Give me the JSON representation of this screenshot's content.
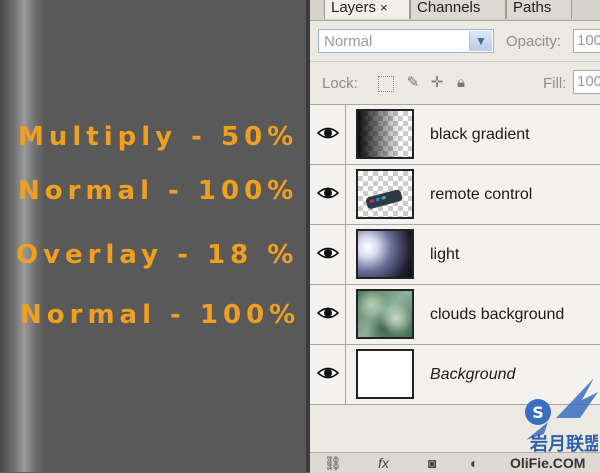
{
  "annotations": [
    "Multiply - 50%",
    "Normal - 100%",
    "Overlay - 18 %",
    "Normal - 100%"
  ],
  "panel": {
    "tabs": [
      {
        "label": "Layers",
        "close": "×",
        "active": true
      },
      {
        "label": "Channels",
        "active": false
      },
      {
        "label": "Paths",
        "active": false
      }
    ],
    "blend_mode": "Normal",
    "opacity_label": "Opacity:",
    "opacity_value": "100",
    "lock_label": "Lock:",
    "fill_label": "Fill:",
    "fill_value": "100"
  },
  "layers": [
    {
      "name": "black gradient",
      "thumb": "black-gradient",
      "visible": true
    },
    {
      "name": "remote control",
      "thumb": "remote-control",
      "visible": true
    },
    {
      "name": "light",
      "thumb": "light",
      "visible": true
    },
    {
      "name": "clouds background",
      "thumb": "clouds",
      "visible": true
    },
    {
      "name": "Background",
      "thumb": "white",
      "visible": true,
      "locked": true
    }
  ],
  "watermark": {
    "text": "OliFie.COM"
  },
  "colors": {
    "annotation": "#f0a020",
    "canvas": "#595959",
    "panel": "#ece9e3"
  }
}
